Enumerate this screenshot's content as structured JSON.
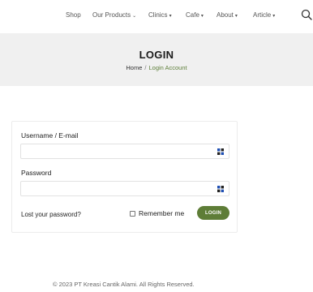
{
  "nav": {
    "items": [
      {
        "label": "Shop",
        "dropdown": false
      },
      {
        "label": "Our Products",
        "dropdown": true
      },
      {
        "label": "Clinics",
        "dropdown": true
      },
      {
        "label": "Cafe",
        "dropdown": true
      },
      {
        "label": "About",
        "dropdown": true
      },
      {
        "label": "Article",
        "dropdown": true
      }
    ],
    "search_icon": "search-icon"
  },
  "hero": {
    "title": "LOGIN",
    "breadcrumb": {
      "home": "Home",
      "separator": "/",
      "current": "Login Account"
    }
  },
  "login_form": {
    "username_label": "Username / E-mail",
    "username_value": "",
    "password_label": "Password",
    "password_value": "",
    "lost_password": "Lost your password?",
    "remember_label": "Remember me",
    "remember_checked": false,
    "submit_label": "LOGIN"
  },
  "footer": {
    "copyright": "© 2023 PT Kreasi Cantik Alami. All Rights Reserved."
  },
  "colors": {
    "accent": "#5e7d37",
    "breadcrumb_current": "#5e7f3a",
    "hero_bg": "#f0f0f0"
  }
}
